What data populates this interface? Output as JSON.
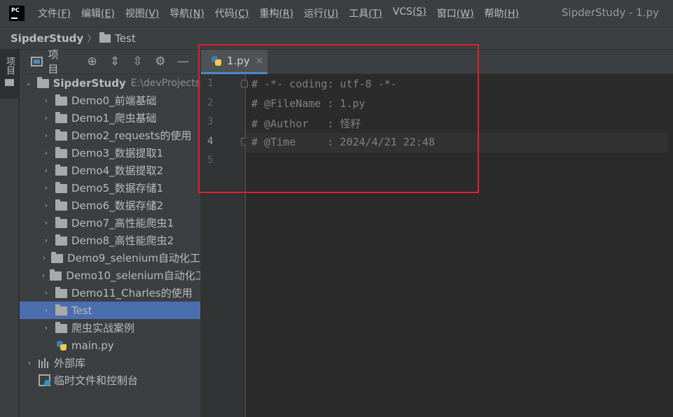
{
  "app": {
    "logo_text": "PC",
    "window_title": "SipderStudy - 1.py"
  },
  "menu": [
    {
      "label": "文件",
      "key": "(F)"
    },
    {
      "label": "编辑",
      "key": "(E)"
    },
    {
      "label": "视图",
      "key": "(V)"
    },
    {
      "label": "导航",
      "key": "(N)"
    },
    {
      "label": "代码",
      "key": "(C)"
    },
    {
      "label": "重构",
      "key": "(R)"
    },
    {
      "label": "运行",
      "key": "(U)"
    },
    {
      "label": "工具",
      "key": "(T)"
    },
    {
      "label": "VCS",
      "key": "(S)"
    },
    {
      "label": "窗口",
      "key": "(W)"
    },
    {
      "label": "帮助",
      "key": "(H)"
    }
  ],
  "breadcrumb": {
    "root": "SipderStudy",
    "separator": "〉",
    "current": "Test"
  },
  "toolstrip": {
    "project_tab": "项目"
  },
  "project_panel": {
    "title": "项目",
    "toolbar_icons": [
      "target-icon",
      "expand-all-icon",
      "collapse-all-icon",
      "gear-icon",
      "hide-icon"
    ],
    "root": {
      "label": "SipderStudy",
      "path": "E:\\devProjects"
    },
    "folders": [
      "Demo0_前端基础",
      "Demo1_爬虫基础",
      "Demo2_requests的使用",
      "Demo3_数据提取1",
      "Demo4_数据提取2",
      "Demo5_数据存储1",
      "Demo6_数据存储2",
      "Demo7_高性能爬虫1",
      "Demo8_高性能爬虫2",
      "Demo9_selenium自动化工",
      "Demo10_selenium自动化工",
      "Demo11_Charles的使用",
      "Test",
      "爬虫实战案例"
    ],
    "selected": "Test",
    "file": "main.py",
    "external_libs": "外部库",
    "scratches": "临时文件和控制台"
  },
  "editor": {
    "tab": {
      "label": "1.py",
      "close": "×"
    },
    "lines": [
      {
        "num": "1",
        "text": "# -*- coding: utf-8 -*-"
      },
      {
        "num": "2",
        "text": "# @FileName : 1.py"
      },
      {
        "num": "3",
        "text": "# @Author   : 怪籽"
      },
      {
        "num": "4",
        "text": "# @Time     : 2024/4/21 22:48"
      },
      {
        "num": "5",
        "text": ""
      }
    ],
    "current_line": "4"
  },
  "colors": {
    "selection": "#4b6eaf",
    "annotation_box": "#e0202a",
    "comment": "#808080"
  }
}
